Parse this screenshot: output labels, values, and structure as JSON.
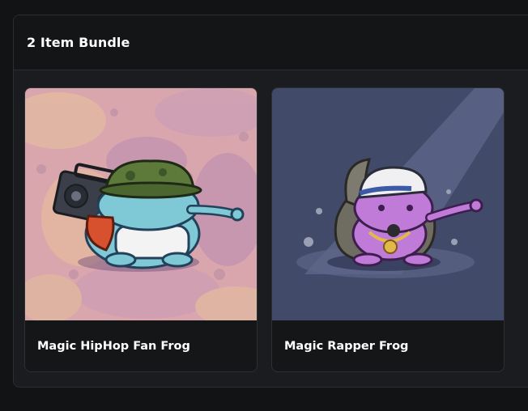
{
  "bundle": {
    "title": "2 Item Bundle",
    "items": [
      {
        "name": "Magic HipHop Fan Frog",
        "image_icon": "hiphop-fan-frog-image"
      },
      {
        "name": "Magic Rapper Frog",
        "image_icon": "rapper-frog-image"
      }
    ]
  },
  "colors": {
    "page_bg": "#121314",
    "panel_bg": "#1a1c1f",
    "card_bg": "#151618",
    "text": "#ffffff"
  }
}
